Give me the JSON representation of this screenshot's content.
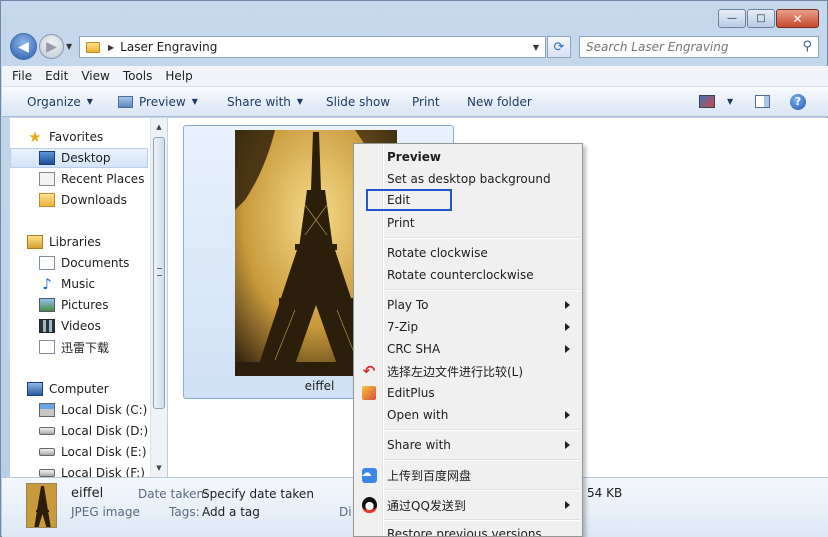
{
  "window": {
    "caption": {
      "minimize": "—",
      "maximize": "□",
      "close": "✕"
    }
  },
  "address": {
    "path": "Laser Engraving",
    "search_placeholder": "Search Laser Engraving"
  },
  "menubar": [
    "File",
    "Edit",
    "View",
    "Tools",
    "Help"
  ],
  "toolbar": {
    "organize": "Organize",
    "preview": "Preview",
    "share_with": "Share with",
    "slide_show": "Slide show",
    "print": "Print",
    "new_folder": "New folder",
    "help": "?"
  },
  "nav": {
    "favorites": "Favorites",
    "desktop": "Desktop",
    "recent_places": "Recent Places",
    "downloads": "Downloads",
    "libraries": "Libraries",
    "documents": "Documents",
    "music": "Music",
    "pictures": "Pictures",
    "videos": "Videos",
    "xunlei": "迅雷下载",
    "computer": "Computer",
    "disk_c": "Local Disk (C:)",
    "disk_d": "Local Disk (D:)",
    "disk_e": "Local Disk (E:)",
    "disk_f": "Local Disk (F:)"
  },
  "file": {
    "name": "eiffel",
    "type": "JPEG image",
    "date_taken_label": "Date taken:",
    "date_taken_value": "Specify date taken",
    "tags_label": "Tags:",
    "tags_value": "Add a tag",
    "dim_label_partial": "Di",
    "size_partial": "54 KB"
  },
  "context_menu": {
    "preview": "Preview",
    "set_background": "Set as desktop background",
    "edit": "Edit",
    "print": "Print",
    "rotate_cw": "Rotate clockwise",
    "rotate_ccw": "Rotate counterclockwise",
    "play_to": "Play To",
    "seven_zip": "7-Zip",
    "crc_sha": "CRC SHA",
    "compare_left": "选择左边文件进行比较(L)",
    "editplus": "EditPlus",
    "open_with": "Open with",
    "share_with": "Share with",
    "baidu_upload": "上传到百度网盘",
    "qq_send": "通过QQ发送到",
    "restore_versions": "Restore previous versions"
  },
  "colors": {
    "selection_border": "#2356c8",
    "tile_selection": "#cfe1f6"
  }
}
